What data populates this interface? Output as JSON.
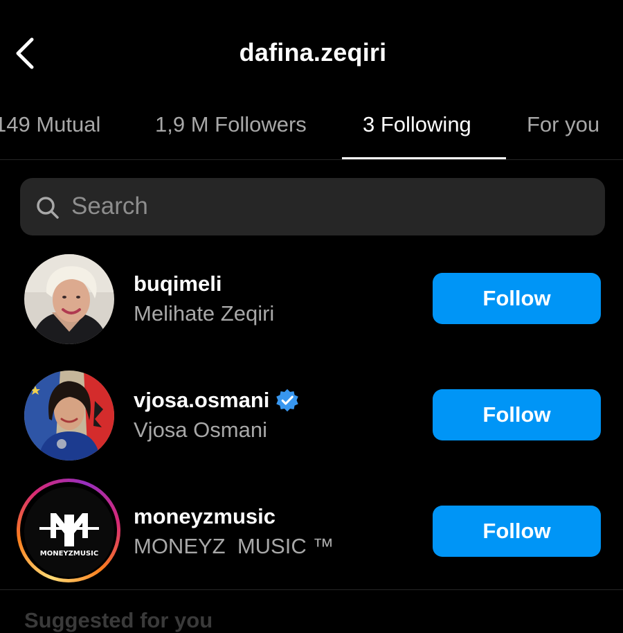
{
  "header": {
    "title": "dafina.zeqiri",
    "back_icon": "chevron-left-icon"
  },
  "tabs": [
    {
      "label": "149 Mutual",
      "active": false
    },
    {
      "label": "1,9 M Followers",
      "active": false
    },
    {
      "label": "3 Following",
      "active": true
    },
    {
      "label": "For you",
      "active": false
    }
  ],
  "search": {
    "placeholder": "Search",
    "icon": "search-icon"
  },
  "following": [
    {
      "username": "buqimeli",
      "full_name": "Melihate Zeqiri",
      "verified": false,
      "button_label": "Follow"
    },
    {
      "username": "vjosa.osmani",
      "full_name": "Vjosa Osmani",
      "verified": true,
      "button_label": "Follow"
    },
    {
      "username": "moneyzmusic",
      "full_name": "MONEYZ  MUSIC ™",
      "verified": false,
      "has_story_ring": true,
      "logo_text": "MONEYZMUSIC",
      "button_label": "Follow"
    }
  ],
  "suggested": {
    "heading": "Suggested for you"
  },
  "colors": {
    "background": "#000000",
    "button_blue": "#0095f6",
    "verified_blue": "#3897f0",
    "secondary_text": "#a8a8a8",
    "search_bg": "#262626"
  }
}
